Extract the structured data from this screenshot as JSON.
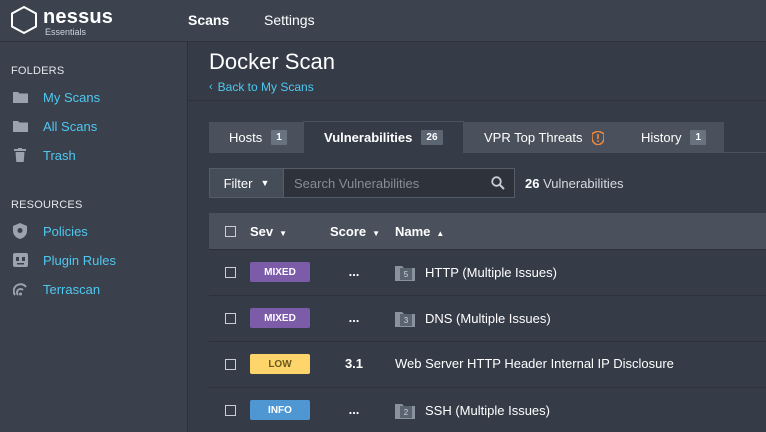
{
  "app": {
    "logo_word": "nessus",
    "logo_sub": "Essentials"
  },
  "topnav": {
    "scans": "Scans",
    "settings": "Settings"
  },
  "sidebar": {
    "folders_head": "FOLDERS",
    "folders": [
      {
        "label": "My Scans",
        "icon": "folder-icon"
      },
      {
        "label": "All Scans",
        "icon": "folder-icon"
      },
      {
        "label": "Trash",
        "icon": "trash-icon"
      }
    ],
    "resources_head": "RESOURCES",
    "resources": [
      {
        "label": "Policies",
        "icon": "policy-shield-icon"
      },
      {
        "label": "Plugin Rules",
        "icon": "plugin-rules-icon"
      },
      {
        "label": "Terrascan",
        "icon": "terrascan-icon"
      }
    ]
  },
  "page": {
    "title": "Docker Scan",
    "back_link": "Back to My Scans"
  },
  "tabs": [
    {
      "label": "Hosts",
      "count": "1"
    },
    {
      "label": "Vulnerabilities",
      "count": "26"
    },
    {
      "label": "VPR Top Threats",
      "icon": "vpr-shield-icon"
    },
    {
      "label": "History",
      "count": "1"
    }
  ],
  "filter": {
    "button": "Filter",
    "placeholder": "Search Vulnerabilities",
    "count_number": "26",
    "count_label": "Vulnerabilities"
  },
  "table": {
    "headers": {
      "sev": "Sev",
      "score": "Score",
      "name": "Name"
    },
    "rows": [
      {
        "sev": "MIXED",
        "sev_color": "#7c5ca8",
        "score": "...",
        "name": "HTTP (Multiple Issues)",
        "group_count": "5"
      },
      {
        "sev": "MIXED",
        "sev_color": "#7c5ca8",
        "score": "...",
        "name": "DNS (Multiple Issues)",
        "group_count": "3"
      },
      {
        "sev": "LOW",
        "sev_color": "#fdd56a",
        "score": "3.1",
        "name": "Web Server HTTP Header Internal IP Disclosure"
      },
      {
        "sev": "INFO",
        "sev_color": "#4f97d3",
        "score": "...",
        "name": "SSH (Multiple Issues)",
        "group_count": "2"
      }
    ]
  },
  "colors": {
    "accent": "#4fc8f0",
    "mixed": "#7c5ca8",
    "low": "#fdd56a",
    "info": "#4f97d3",
    "vpr_icon": "#f28a3c"
  }
}
